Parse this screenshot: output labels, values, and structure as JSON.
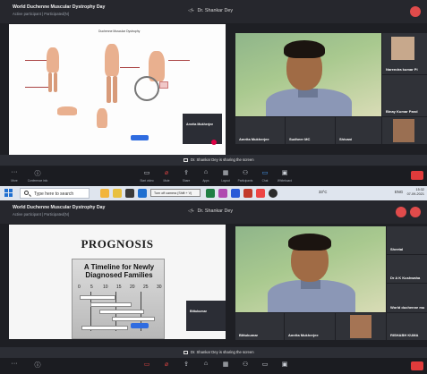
{
  "meeting": {
    "title": "World Duchenne Muscular Dystrophy Day",
    "subtitle": "Active participant | Participated(N)",
    "presenter": "Dr. Shankar Dey",
    "sharing_text": "Dr. Shankar Dey is sharing the screen"
  },
  "shot1": {
    "slide": {
      "diagram_title": "Duchenne Muscular Dystrophy"
    },
    "self_view": {
      "name": "Amrita Mukherjee"
    },
    "tiles": [
      {
        "name": "Narendra kumar Pi"
      },
      {
        "name": "Binay Kumar Pand"
      },
      {
        "name": "Amrita Mukherjee"
      },
      {
        "name": "Sudheer MC"
      },
      {
        "name": "Shivani"
      }
    ],
    "toolbar": [
      {
        "icon": "more-icon",
        "label": "More"
      },
      {
        "icon": "info-icon",
        "label": "Conference info"
      },
      {
        "icon": "camera-icon",
        "label": "Start video"
      },
      {
        "icon": "mic-icon",
        "label": "Mute"
      },
      {
        "icon": "share-icon",
        "label": "Share"
      },
      {
        "icon": "apps-icon",
        "label": "Apps"
      },
      {
        "icon": "layout-icon",
        "label": "Layout"
      },
      {
        "icon": "participants-icon",
        "label": "Participants"
      },
      {
        "icon": "chat-icon",
        "label": "Chat"
      },
      {
        "icon": "whiteboard-icon",
        "label": "Whiteboard"
      }
    ]
  },
  "taskbar": {
    "search_placeholder": "Type here to search",
    "tooltip": "Turn off camera (Shift + V)",
    "weather": "33°C",
    "lang": "ENG",
    "time": "15:32",
    "date": "07-09-2021"
  },
  "shot2": {
    "slide": {
      "title": "PROGNOSIS",
      "timeline_title": "A Timeline for Newly Diagnosed Families",
      "ticks": [
        "0",
        "5",
        "10",
        "15",
        "20",
        "25",
        "30"
      ]
    },
    "self_view": {
      "name": "Bittukumar"
    },
    "tiles": [
      {
        "name": "Sheetal"
      },
      {
        "name": "Dr A K Kushwaha"
      },
      {
        "name": "World duchenne mu"
      },
      {
        "name": "Bittukumar"
      },
      {
        "name": "Amrita Mukherjee"
      },
      {
        "name": "RISHABH KUMA"
      }
    ]
  }
}
